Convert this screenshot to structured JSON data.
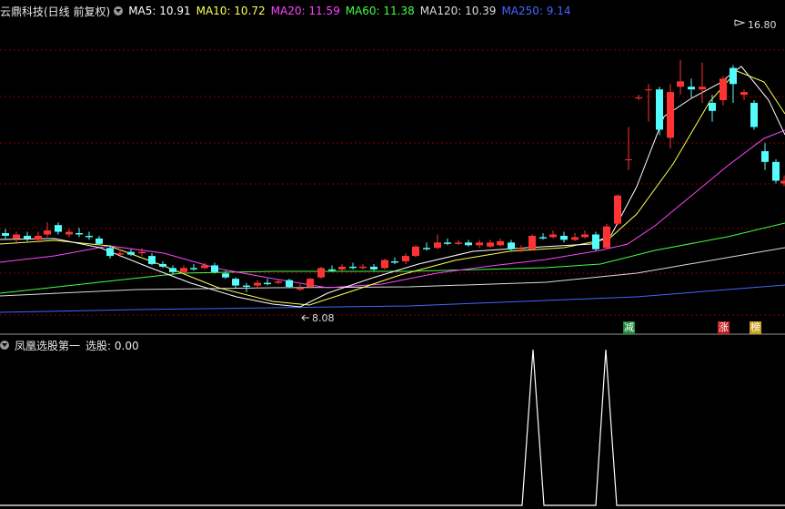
{
  "main_header": {
    "stock": "云鼎科技(日线 前复权)",
    "ma": [
      {
        "label": "MA5: 10.91",
        "color": "#ffffff"
      },
      {
        "label": "MA10: 10.72",
        "color": "#ffff55"
      },
      {
        "label": "MA20: 11.59",
        "color": "#ff44ff"
      },
      {
        "label": "MA60: 11.38",
        "color": "#44ff44"
      },
      {
        "label": "MA120: 10.39",
        "color": "#dddddd"
      },
      {
        "label": "MA250: 9.14",
        "color": "#4466ff"
      }
    ]
  },
  "annotations": {
    "high": "16.80",
    "low": "8.08"
  },
  "tags": [
    {
      "text": "减",
      "bg": "#1e8c3a"
    },
    {
      "text": "涨",
      "bg": "#c02020"
    },
    {
      "text": "榜",
      "bg": "#c8a020"
    }
  ],
  "sub_header": {
    "title": "凤凰选股第一",
    "value_label": "选股: 0.00"
  },
  "colors": {
    "up": "#ff3333",
    "down": "#54fcfc",
    "grid": "#880000",
    "signal": "#ffffff"
  },
  "chart_data": {
    "type": "candlestick",
    "series": [
      {
        "name": "MA5",
        "color": "#ffffff"
      },
      {
        "name": "MA10",
        "color": "#ffff55"
      },
      {
        "name": "MA20",
        "color": "#ff44ff"
      },
      {
        "name": "MA60",
        "color": "#44ff44"
      },
      {
        "name": "MA120",
        "color": "#dddddd"
      },
      {
        "name": "MA250",
        "color": "#4466ff"
      }
    ],
    "ma_values": {
      "MA5": 10.91,
      "MA10": 10.72,
      "MA20": 11.59,
      "MA60": 11.38,
      "MA120": 10.39,
      "MA250": 9.14
    },
    "high": 16.8,
    "low": 8.08,
    "indicator": {
      "name": "选股",
      "value": 0.0
    }
  }
}
